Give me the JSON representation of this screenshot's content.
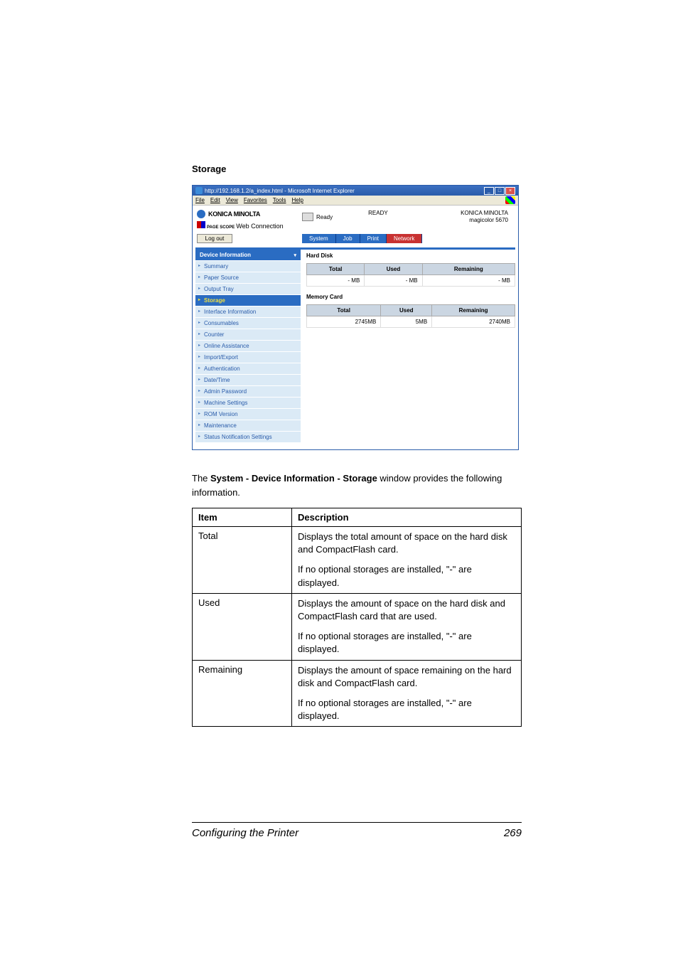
{
  "section_title": "Storage",
  "browser": {
    "title": "http://192.168.1.2/a_index.html - Microsoft Internet Explorer",
    "menus": [
      "File",
      "Edit",
      "View",
      "Favorites",
      "Tools",
      "Help"
    ],
    "brand": "KONICA MINOLTA",
    "pagescope_prefix": "PAGE SCOPE",
    "pagescope": "Web Connection",
    "printer_status_short": "Ready",
    "printer_status": "READY",
    "device_line1": "KONICA MINOLTA",
    "device_line2": "magicolor 5670",
    "logout": "Log out",
    "tabs": [
      "System",
      "Job",
      "Print",
      "Network"
    ],
    "side_header": "Device Information",
    "side_items": [
      "Summary",
      "Paper Source",
      "Output Tray",
      "Storage",
      "Interface Information",
      "Consumables",
      "Counter",
      "Online Assistance",
      "Import/Export",
      "Authentication",
      "Date/Time",
      "Admin Password",
      "Machine Settings",
      "ROM Version",
      "Maintenance",
      "Status Notification Settings"
    ],
    "active_index": 3,
    "hd_heading": "Hard Disk",
    "mc_heading": "Memory Card",
    "cols": {
      "total": "Total",
      "used": "Used",
      "remaining": "Remaining"
    },
    "hd_row": {
      "total": "- MB",
      "used": "- MB",
      "remaining": "- MB"
    },
    "mc_row": {
      "total": "2745MB",
      "used": "5MB",
      "remaining": "2740MB"
    }
  },
  "intro": {
    "prefix": "The ",
    "bold": "System - Device Information - Storage",
    "suffix": " window provides the following information."
  },
  "info_table": {
    "headers": {
      "item": "Item",
      "description": "Description"
    },
    "rows": [
      {
        "item": "Total",
        "p1": "Displays the total amount of space on the hard disk and CompactFlash card.",
        "p2": "If no optional storages are installed, \"-\" are displayed."
      },
      {
        "item": "Used",
        "p1": "Displays the amount of space on the hard disk and CompactFlash card that are used.",
        "p2": "If no optional storages are installed, \"-\" are displayed."
      },
      {
        "item": "Remaining",
        "p1": "Displays the amount of space remaining on the hard disk and CompactFlash card.",
        "p2": "If no optional storages are installed, \"-\" are displayed."
      }
    ]
  },
  "footer": {
    "title": "Configuring the Printer",
    "page": "269"
  }
}
